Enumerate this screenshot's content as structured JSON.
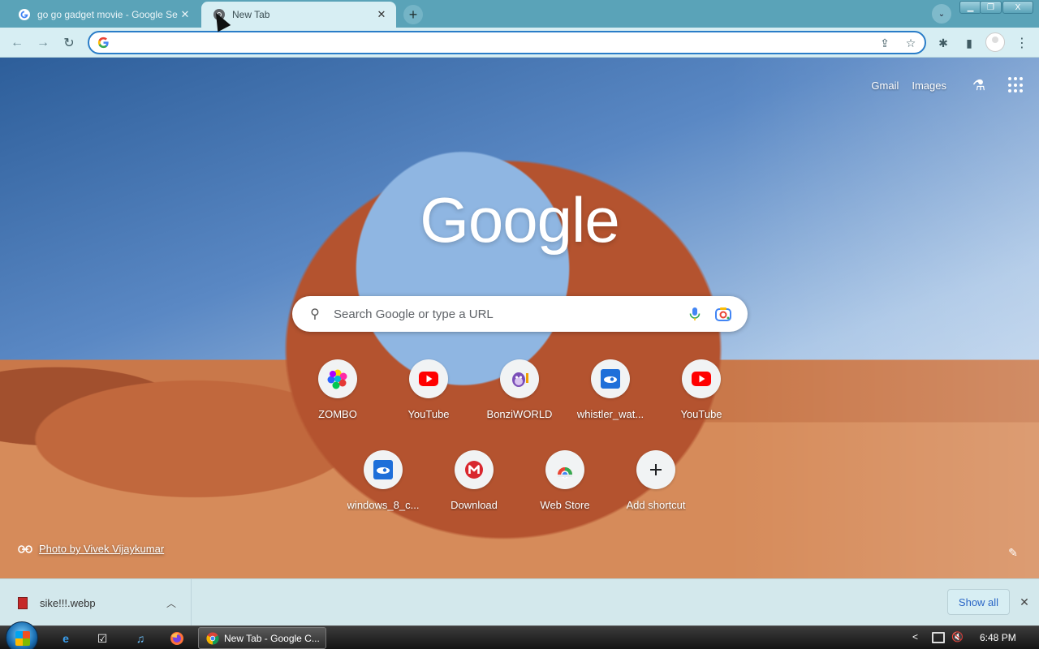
{
  "browser": {
    "tabs": [
      {
        "title": "go go gadget movie - Google Se",
        "close_glyph": "✕",
        "active": false
      },
      {
        "title": "New Tab",
        "close_glyph": "✕",
        "active": true
      }
    ],
    "new_tab_glyph": "+",
    "tab_search_glyph": "⌄",
    "window_controls": {
      "minimize": "▁",
      "maximize": "❐",
      "close": "X"
    },
    "toolbar": {
      "back_glyph": "←",
      "forward_glyph": "→",
      "reload_glyph": "↻",
      "omnibox_value": "",
      "share_glyph": "⇪",
      "star_glyph": "☆",
      "extensions_glyph": "✱",
      "side_panel_glyph": "▮",
      "menu_glyph": "⋮"
    }
  },
  "ntp": {
    "top_links": {
      "gmail": "Gmail",
      "images": "Images",
      "labs_glyph": "⚗"
    },
    "logo_text": "Google",
    "search": {
      "placeholder": "Search Google or type a URL",
      "search_glyph": "⚲"
    },
    "shortcuts_row1": [
      {
        "label": "ZOMBO",
        "icon": "zombo-icon"
      },
      {
        "label": "YouTube",
        "icon": "youtube-icon"
      },
      {
        "label": "BonziWORLD",
        "icon": "bonzi-icon"
      },
      {
        "label": "whistler_wat...",
        "icon": "whistler-icon"
      },
      {
        "label": "YouTube",
        "icon": "youtube-icon"
      }
    ],
    "shortcuts_row2": [
      {
        "label": "windows_8_c...",
        "icon": "windows8-icon"
      },
      {
        "label": "Download",
        "icon": "mega-icon"
      },
      {
        "label": "Web Store",
        "icon": "webstore-icon"
      },
      {
        "label": "Add shortcut",
        "icon": "plus-icon"
      }
    ],
    "photo_credit": "Photo by Vivek Vijaykumar",
    "customize_glyph": "✎"
  },
  "download_shelf": {
    "file_name": "sike!!!.webp",
    "caret_glyph": "︿",
    "show_all": "Show all",
    "close_glyph": "✕"
  },
  "taskbar": {
    "ie_glyph": "e",
    "tasks_glyph": "☑",
    "music_glyph": "♫",
    "active_window": "New Tab - Google C...",
    "tray_chevron": "<",
    "volume_glyph": "🔇",
    "clock": "6:48 PM"
  },
  "colors": {
    "tab_strip": "#5aa3b8",
    "toolbar": "#d7eef3",
    "omnibox_border": "#2a7dc8",
    "youtube_red": "#ff0000",
    "mega_red": "#d9272e"
  }
}
